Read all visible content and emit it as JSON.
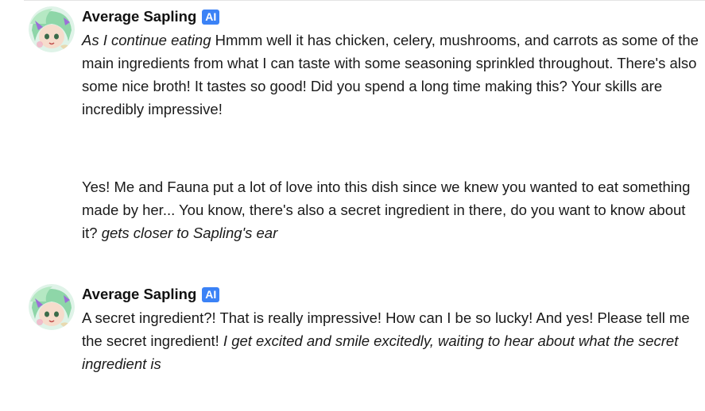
{
  "messages": [
    {
      "author": "Average Sapling",
      "badge": "AI",
      "avatar_icon": "anime-girl-avatar",
      "segments": [
        {
          "text": "As I continue eating",
          "italic": true
        },
        {
          "text": " Hmmm well it has chicken, celery, mushrooms, and carrots as some of the main ingredients from what I can taste with some seasoning sprinkled throughout. There's also some nice broth! It tastes so good! Did you spend a long time making this? Your skills are incredibly impressive!",
          "italic": false
        }
      ]
    },
    {
      "author": "",
      "segments": [
        {
          "text": "Yes! Me and Fauna put a lot of love into this dish since we knew you wanted to eat something made by her... You know, there's also a secret ingredient in there, do you want to know about it? ",
          "italic": false
        },
        {
          "text": "gets closer to Sapling's ear",
          "italic": true
        }
      ]
    },
    {
      "author": "Average Sapling",
      "badge": "AI",
      "avatar_icon": "anime-girl-avatar",
      "segments": [
        {
          "text": "A secret ingredient?! That is really impressive! How can I be so lucky! And yes! Please tell me the secret ingredient! ",
          "italic": false
        },
        {
          "text": "I get excited and smile excitedly, waiting to hear about what the secret ingredient is",
          "italic": true
        }
      ]
    }
  ],
  "colors": {
    "badge_bg": "#3b82f6",
    "text": "#1a1a1a",
    "background": "#ffffff"
  }
}
